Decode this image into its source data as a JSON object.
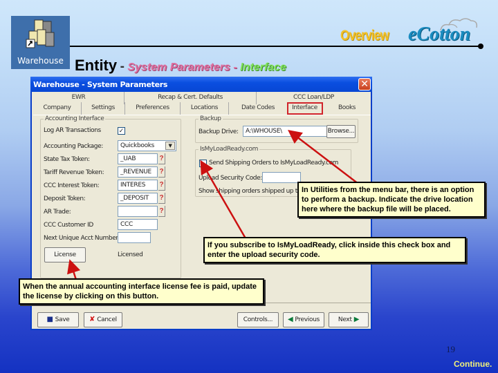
{
  "header": {
    "app_icon_label": "Warehouse",
    "overview": "Overview",
    "brand": "eCotton",
    "title_entity": "Entity",
    "title_sep": "-",
    "title_section": "System Parameters",
    "title_sep2": "-",
    "title_sub": "Interface"
  },
  "window": {
    "title": "Warehouse - System Parameters",
    "close_glyph": "✕",
    "tabs_row1": [
      "EWR",
      "Recap & Cert. Defaults",
      "CCC Loan/LDP"
    ],
    "tabs_row2": [
      "Company",
      "Settings",
      "Preferences",
      "Locations",
      "Date Codes",
      "Interface",
      "Books"
    ],
    "active_tab": "Interface",
    "accounting": {
      "legend": "Accounting Interface",
      "fields": [
        {
          "label": "Log AR Transactions",
          "type": "checkbox",
          "checked": true
        },
        {
          "label": "Accounting Package:",
          "type": "select",
          "value": "Quickbooks"
        },
        {
          "label": "State Tax Token:",
          "type": "text",
          "value": "_UAB",
          "help": "?"
        },
        {
          "label": "Tariff Revenue Token:",
          "type": "text",
          "value": "_REVENUE",
          "help": "?"
        },
        {
          "label": "CCC Interest Token:",
          "type": "text",
          "value": "INTERES",
          "help": "?"
        },
        {
          "label": "Deposit Token:",
          "type": "text",
          "value": "_DEPOSIT",
          "help": "?"
        },
        {
          "label": "AR Trade:",
          "type": "text",
          "value": "",
          "help": "?"
        },
        {
          "label": "CCC Customer ID",
          "type": "text",
          "value": "CCC"
        },
        {
          "label": "Next Unique Acct Number",
          "type": "text",
          "value": ""
        }
      ],
      "license_button": "License",
      "license_status": "Licensed"
    },
    "backup": {
      "legend": "Backup",
      "drive_label": "Backup Drive:",
      "drive_value": "A:\\WHOUSE\\",
      "browse_button": "Browse..."
    },
    "ismyloadready": {
      "legend": "IsMyLoadReady.com",
      "send_label": "Send Shipping Orders to IsMyLoadReady.com",
      "send_checked": false,
      "security_label": "Upload Security Code:",
      "security_value": "",
      "show_label": "Show shipping orders shipped up to"
    },
    "buttons": {
      "save": "Save",
      "cancel": "Cancel",
      "controls": "Controls...",
      "previous": "Previous",
      "next": "Next"
    }
  },
  "callouts": {
    "backup": "In Utilities from the menu bar, there is an option to perform a backup.  Indicate the drive location here where the backup file will be placed.",
    "ismyloadready": "If you subscribe to IsMyLoadReady, click inside this check box and enter the upload security code.",
    "license": "When the annual accounting interface license fee is paid, update the license by clicking on this button."
  },
  "footer": {
    "page_number": "19",
    "continue": "Continue."
  },
  "colors": {
    "titlebar": "#0a4ee0",
    "callout_bg": "#ffffcc",
    "arrow": "#cc1111",
    "active_tab_outline": "#d0232a",
    "overview": "#f3c227",
    "brand": "#1a8cc0",
    "section_pink": "#e06fa0",
    "section_green": "#7fe25a"
  }
}
